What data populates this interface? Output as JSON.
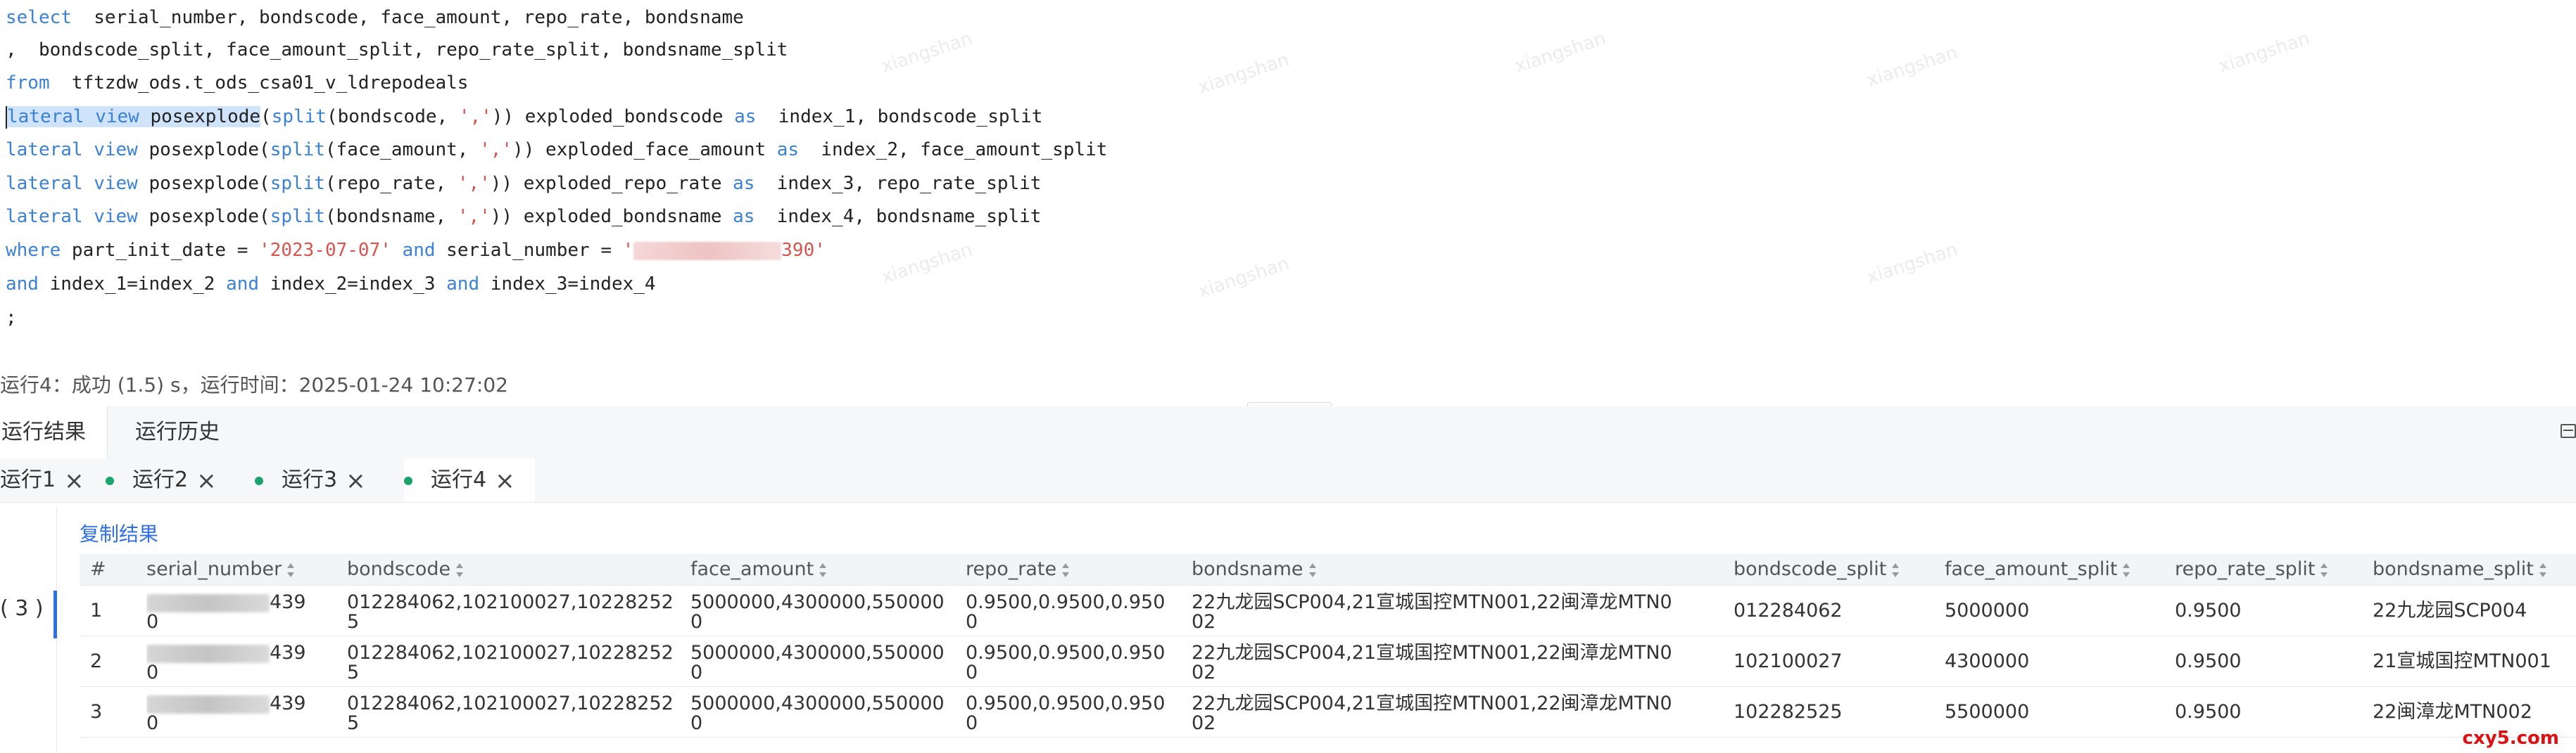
{
  "editor": {
    "lines": [
      {
        "parts": [
          [
            "kw",
            "select"
          ],
          [
            "",
            "  serial_number, bondscode, face_amount, repo_rate, bondsname"
          ]
        ]
      },
      {
        "parts": [
          [
            "",
            ",  bondscode_split, face_amount_split, repo_rate_split, bondsname_split"
          ]
        ]
      },
      {
        "parts": [
          [
            "kw",
            "from"
          ],
          [
            "",
            "  tftzdw_ods.t_ods_csa01_v_ldrepodeals"
          ]
        ]
      },
      {
        "parts": [
          [
            "sel kw",
            "lateral view"
          ],
          [
            "sel",
            " posexplode"
          ],
          [
            "",
            "("
          ],
          [
            "kw",
            "split"
          ],
          [
            "",
            "(bondscode, "
          ],
          [
            "str",
            "','"
          ],
          [
            "",
            ")) exploded_bondscode "
          ],
          [
            "kw",
            "as"
          ],
          [
            "",
            "  index_1, bondscode_split"
          ]
        ]
      },
      {
        "parts": [
          [
            "kw",
            "lateral view"
          ],
          [
            "",
            " posexplode("
          ],
          [
            "kw",
            "split"
          ],
          [
            "",
            "(face_amount, "
          ],
          [
            "str",
            "','"
          ],
          [
            "",
            ")) exploded_face_amount "
          ],
          [
            "kw",
            "as"
          ],
          [
            "",
            "  index_2, face_amount_split"
          ]
        ]
      },
      {
        "parts": [
          [
            "kw",
            "lateral view"
          ],
          [
            "",
            " posexplode("
          ],
          [
            "kw",
            "split"
          ],
          [
            "",
            "(repo_rate, "
          ],
          [
            "str",
            "','"
          ],
          [
            "",
            ")) exploded_repo_rate "
          ],
          [
            "kw",
            "as"
          ],
          [
            "",
            "  index_3, repo_rate_split"
          ]
        ]
      },
      {
        "parts": [
          [
            "kw",
            "lateral view"
          ],
          [
            "",
            " posexplode("
          ],
          [
            "kw",
            "split"
          ],
          [
            "",
            "(bondsname, "
          ],
          [
            "str",
            "','"
          ],
          [
            "",
            ")) exploded_bondsname "
          ],
          [
            "kw",
            "as"
          ],
          [
            "",
            "  index_4, bondsname_split"
          ]
        ]
      },
      {
        "parts": [
          [
            "kw",
            "where"
          ],
          [
            "",
            " part_init_date = "
          ],
          [
            "str",
            "'2023-07-07'"
          ],
          [
            "kw",
            " and"
          ],
          [
            "",
            " serial_number = "
          ],
          [
            "str",
            "'"
          ],
          [
            "mask",
            ""
          ],
          [
            "str",
            "390'"
          ]
        ]
      },
      {
        "parts": [
          [
            "kw",
            "and"
          ],
          [
            "",
            " index_1=index_2 "
          ],
          [
            "kw",
            "and"
          ],
          [
            "",
            " index_2=index_3 "
          ],
          [
            "kw",
            "and"
          ],
          [
            "",
            " index_3=index_4"
          ]
        ]
      },
      {
        "parts": [
          [
            "",
            ";"
          ]
        ]
      }
    ]
  },
  "status_text": "运行4：成功 (1.5) s，运行时间：2025-01-24 10:27:02",
  "result_tabs": [
    "运行结果",
    "运行历史"
  ],
  "run_tabs": [
    {
      "label": "运行1",
      "dot": false
    },
    {
      "label": "运行2",
      "dot": true
    },
    {
      "label": "运行3",
      "dot": true
    },
    {
      "label": "运行4",
      "dot": true
    }
  ],
  "close_glyph": "×",
  "gutter_label": "( 3 )",
  "copy_link": "复制结果",
  "table": {
    "columns": [
      "#",
      "serial_number",
      "bondscode",
      "face_amount",
      "repo_rate",
      "bondsname",
      "bondscode_split",
      "face_amount_split",
      "repo_rate_split",
      "bondsname_split"
    ],
    "rows": [
      [
        "1",
        "439\n0",
        "012284062,102100027,10228252\n5",
        "5000000,4300000,550000\n0",
        "0.9500,0.9500,0.950\n0",
        "22九龙园SCP004,21宣城国控MTN001,22闽漳龙MTN0\n02",
        "012284062",
        "5000000",
        "0.9500",
        "22九龙园SCP004"
      ],
      [
        "2",
        "439\n0",
        "012284062,102100027,10228252\n5",
        "5000000,4300000,550000\n0",
        "0.9500,0.9500,0.950\n0",
        "22九龙园SCP004,21宣城国控MTN001,22闽漳龙MTN0\n02",
        "102100027",
        "4300000",
        "0.9500",
        "21宣城国控MTN001"
      ],
      [
        "3",
        "439\n0",
        "012284062,102100027,10228252\n5",
        "5000000,4300000,550000\n0",
        "0.9500,0.9500,0.950\n0",
        "22九龙园SCP004,21宣城国控MTN001,22闽漳龙MTN0\n02",
        "102282525",
        "5500000",
        "0.9500",
        "22闽漳龙MTN002"
      ]
    ]
  },
  "watermarks": [
    "xiangshan",
    "xiangshan",
    "xiangshan",
    "xiangshan",
    "xiangshan",
    "xiangshan",
    "xiangshan",
    "xiangshan"
  ],
  "corner_watermark": "cxy5.com"
}
